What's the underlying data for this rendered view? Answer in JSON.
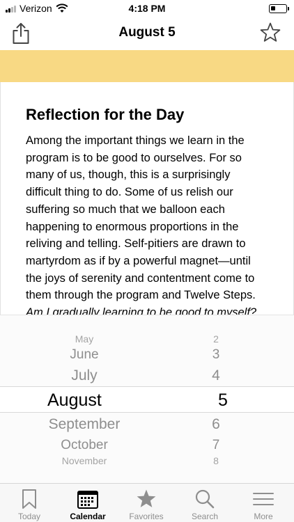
{
  "status_bar": {
    "carrier": "Verizon",
    "time": "4:18 PM"
  },
  "nav": {
    "title": "August 5"
  },
  "reflection": {
    "title": "Reflection for the Day",
    "lines": [
      "Among the important things we learn in the",
      "program is to be good to ourselves. For so",
      "many of us, though, this is a surprisingly",
      "difficult thing to do. Some of us relish our",
      "suffering so much that we balloon each",
      "happening to enormous proportions in the",
      "reliving and telling. Self-pitiers are drawn to",
      "martyrdom as if by a powerful magnet—until",
      "the joys of serenity and contentment come to",
      "them through the program and Twelve Steps."
    ],
    "question": "Am I gradually learning to be good to myself?"
  },
  "picker": {
    "months_above": [
      "May",
      "June",
      "July"
    ],
    "selected_month": "August",
    "months_below": [
      "September",
      "October",
      "November"
    ],
    "days_above": [
      "2",
      "3",
      "4"
    ],
    "selected_day": "5",
    "days_below": [
      "6",
      "7",
      "8"
    ]
  },
  "tabs": [
    {
      "label": "Today",
      "icon": "bookmark-icon"
    },
    {
      "label": "Calendar",
      "icon": "calendar-icon"
    },
    {
      "label": "Favorites",
      "icon": "star-icon"
    },
    {
      "label": "Search",
      "icon": "search-icon"
    },
    {
      "label": "More",
      "icon": "menu-icon"
    }
  ],
  "colors": {
    "accent_band": "#f8d984",
    "inactive_tab": "#8e8e8e"
  }
}
